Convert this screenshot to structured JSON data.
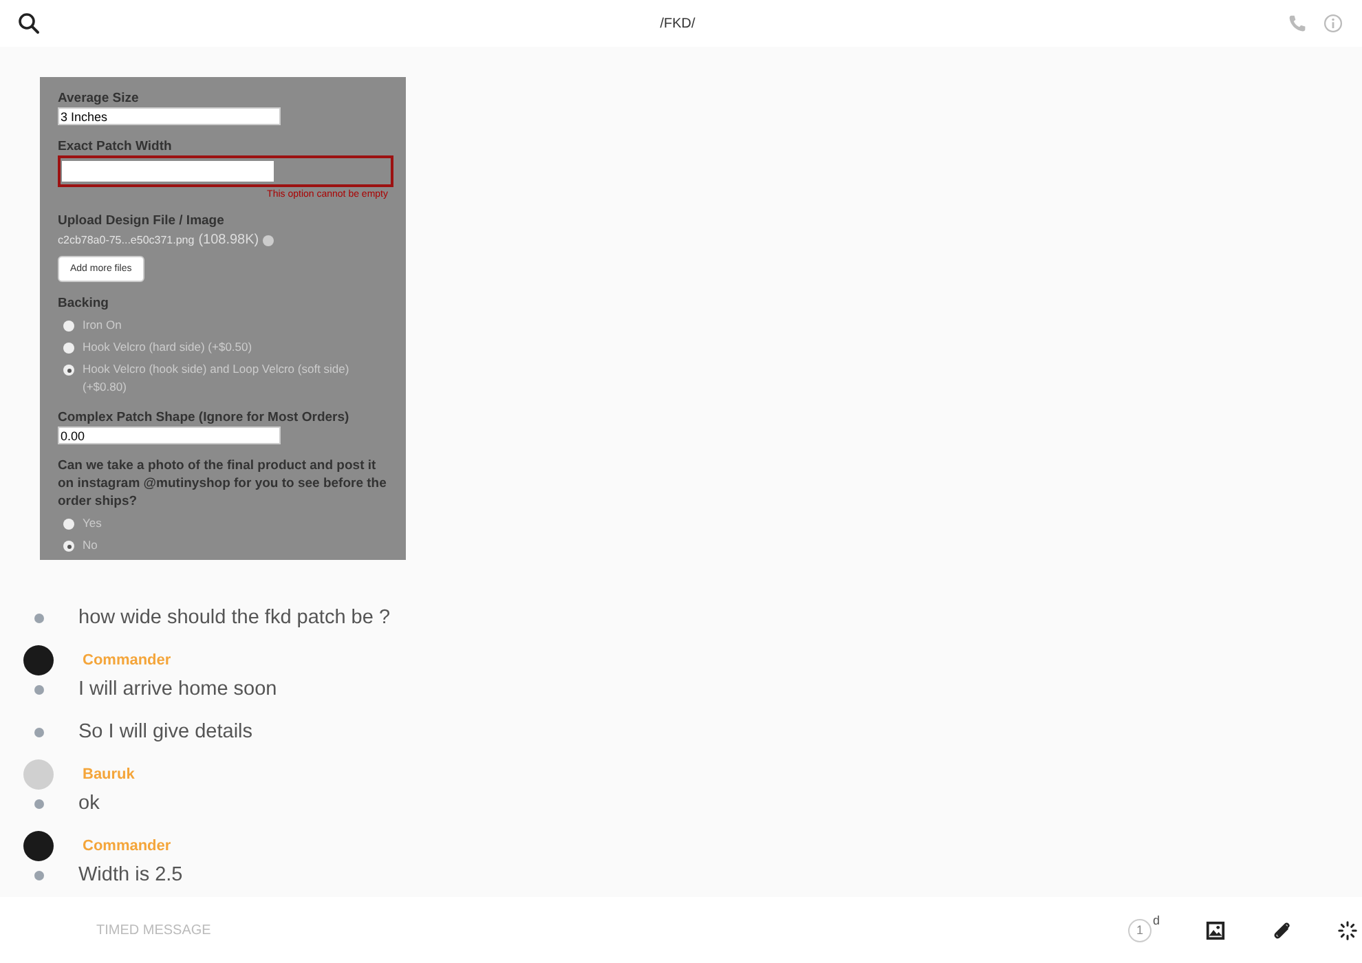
{
  "header": {
    "title": "/FKD/"
  },
  "groups": [
    {
      "items": [
        {
          "kind": "image",
          "fields": [
            {
              "kind": "text_input",
              "label": "Average Size",
              "value": "3 Inches"
            },
            {
              "kind": "error_input",
              "label": "Exact Patch Width",
              "error": "This option cannot be empty"
            },
            {
              "kind": "upload",
              "label": "Upload Design File / Image",
              "filename": "c2cb78a0-75...e50c371.png",
              "size": "(108.98K)",
              "button": "Add more files"
            },
            {
              "kind": "radio_group",
              "label": "Backing",
              "options": [
                {
                  "label": "Iron On",
                  "selected": false
                },
                {
                  "label": "Hook Velcro (hard side) (+$0.50)",
                  "selected": false
                },
                {
                  "label": "Hook Velcro (hook side) and Loop Velcro (soft side) (+$0.80)",
                  "selected": true
                }
              ]
            },
            {
              "kind": "text_input",
              "label": "Complex Patch Shape (Ignore for Most Orders)",
              "value": "0.00"
            },
            {
              "kind": "radio_group",
              "label": "Can we take a photo of the final product and post it on instagram @mutinyshop for you to see before the order ships?",
              "options": [
                {
                  "label": "Yes",
                  "selected": false
                },
                {
                  "label": "No",
                  "selected": true
                }
              ]
            }
          ]
        },
        {
          "kind": "text",
          "text": "how wide should the fkd patch be ?"
        }
      ]
    },
    {
      "author": "Commander",
      "color": "#1a1a1a",
      "items": [
        {
          "kind": "text",
          "text": "I will arrive home soon"
        },
        {
          "kind": "text",
          "text": "So I will give details"
        }
      ]
    },
    {
      "author": "Bauruk",
      "color": "#d0d0d0",
      "items": [
        {
          "kind": "text",
          "text": "ok"
        }
      ]
    },
    {
      "author": "Commander",
      "color": "#1a1a1a",
      "items": [
        {
          "kind": "text",
          "text": "Width is 2.5"
        }
      ]
    }
  ],
  "composer": {
    "placeholder": "TIMED MESSAGE",
    "timer": {
      "count": "1",
      "unit": "d"
    }
  }
}
